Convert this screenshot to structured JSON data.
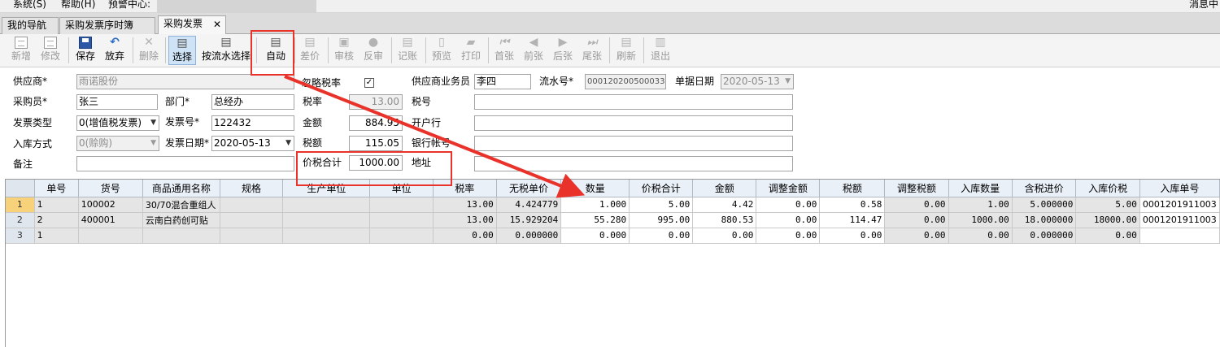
{
  "menu": {
    "system": "系统(S)",
    "help": "帮助(H)",
    "alert_center": "预警中心:",
    "message_center": "消息中"
  },
  "tabs": [
    {
      "label": "我的导航"
    },
    {
      "label": "采购发票序时簿"
    },
    {
      "label": "采购发票"
    }
  ],
  "toolbar": {
    "new": "新增",
    "edit": "修改",
    "save": "保存",
    "discard": "放弃",
    "delete": "删除",
    "select": "选择",
    "select_by_serial": "按流水选择",
    "auto": "自动",
    "price_diff": "差价",
    "review": "审核",
    "unreview": "反审",
    "post": "记账",
    "preview": "预览",
    "print": "打印",
    "first": "首张",
    "prev": "前张",
    "next": "后张",
    "last": "尾张",
    "refresh": "刷新",
    "exit": "退出"
  },
  "form": {
    "supplier_label": "供应商*",
    "supplier_value": "雨诺股份",
    "ignore_tax_label": "忽略税率",
    "ignore_tax_checked": "✓",
    "supplier_staff_label": "供应商业务员",
    "supplier_staff_value": "李四",
    "serial_label": "流水号*",
    "serial_value": "000120200500033",
    "doc_date_label": "单据日期",
    "doc_date_value": "2020-05-13",
    "buyer_label": "采购员*",
    "buyer_value": "张三",
    "dept_label": "部门*",
    "dept_value": "总经办",
    "tax_rate_label": "税率",
    "tax_rate_value": "13.00",
    "tax_no_label": "税号",
    "tax_no_value": "",
    "invoice_type_label": "发票类型",
    "invoice_type_value": "0(增值税发票)",
    "invoice_no_label": "发票号*",
    "invoice_no_value": "122432",
    "amount_label": "金额",
    "amount_value": "884.95",
    "bank_label": "开户行",
    "bank_value": "",
    "stock_in_label": "入库方式",
    "stock_in_value": "0(赊购)",
    "invoice_date_label": "发票日期*",
    "invoice_date_value": "2020-05-13",
    "tax_amount_label": "税额",
    "tax_amount_value": "115.05",
    "bank_account_label": "银行帐号",
    "bank_account_value": "",
    "remark_label": "备注",
    "remark_value": "",
    "total_label": "价税合计",
    "total_value": "1000.00",
    "address_label": "地址",
    "address_value": ""
  },
  "grid": {
    "columns": [
      "单号",
      "货号",
      "商品通用名称",
      "规格",
      "生产单位",
      "单位",
      "税率",
      "无税单价",
      "数量",
      "价税合计",
      "金额",
      "调整金额",
      "税额",
      "调整税额",
      "入库数量",
      "含税进价",
      "入库价税",
      "入库单号"
    ],
    "rows": [
      {
        "rowno": "1",
        "cells": [
          "1",
          "100002",
          "30/70混合重组人",
          "",
          "",
          "",
          "13.00",
          "4.424779",
          "1.000",
          "5.00",
          "4.42",
          "0.00",
          "0.58",
          "0.00",
          "1.00",
          "5.000000",
          "5.00",
          "0001201911003"
        ]
      },
      {
        "rowno": "2",
        "cells": [
          "2",
          "400001",
          "云南白药创可贴",
          "",
          "",
          "",
          "13.00",
          "15.929204",
          "55.280",
          "995.00",
          "880.53",
          "0.00",
          "114.47",
          "0.00",
          "1000.00",
          "18.000000",
          "18000.00",
          "0001201911003"
        ]
      },
      {
        "rowno": "3",
        "cells": [
          "1",
          "",
          "",
          "",
          "",
          "",
          "0.00",
          "0.000000",
          "0.000",
          "0.00",
          "0.00",
          "0.00",
          "0.00",
          "0.00",
          "0.00",
          "0.000000",
          "0.00",
          ""
        ]
      }
    ]
  },
  "annotation": {
    "color": "#e8322a"
  }
}
